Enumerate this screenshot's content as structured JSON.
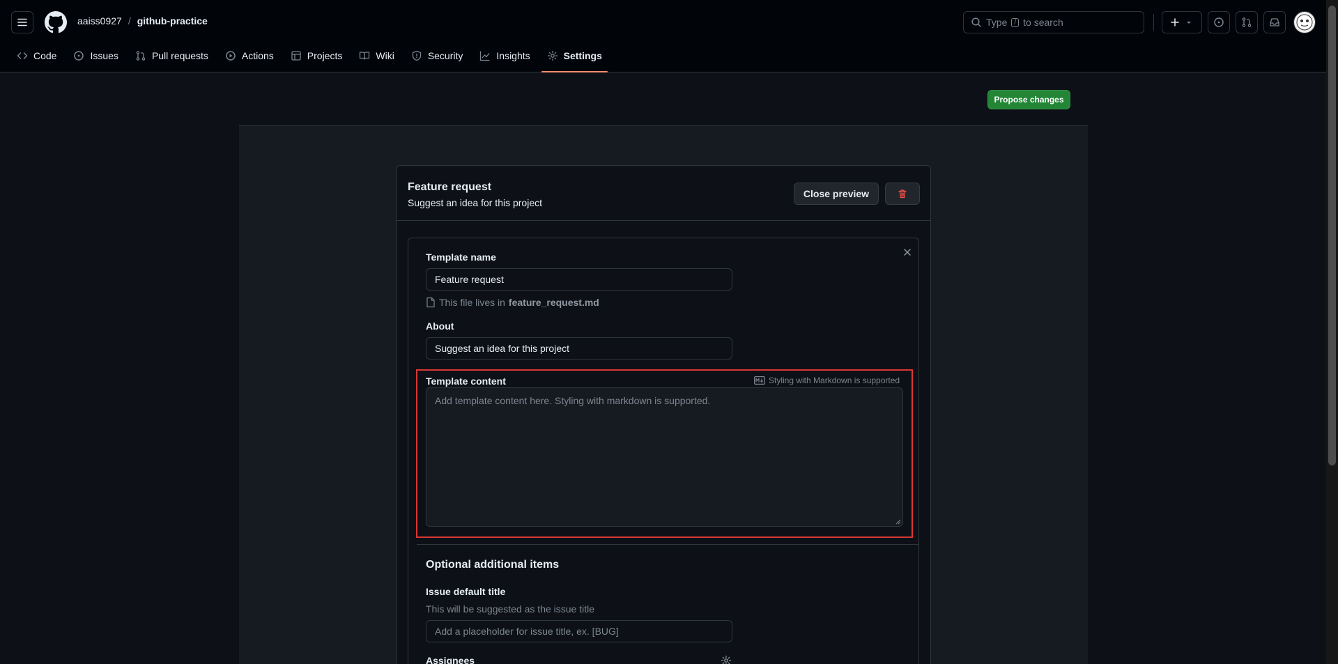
{
  "header": {
    "owner": "aaiss0927",
    "separator": "/",
    "repo": "github-practice",
    "search_prefix": "Type",
    "search_key": "/",
    "search_suffix": "to search"
  },
  "tabs": [
    {
      "label": "Code",
      "icon": "code-icon"
    },
    {
      "label": "Issues",
      "icon": "issue-icon"
    },
    {
      "label": "Pull requests",
      "icon": "pull-request-icon"
    },
    {
      "label": "Actions",
      "icon": "play-icon"
    },
    {
      "label": "Projects",
      "icon": "table-icon"
    },
    {
      "label": "Wiki",
      "icon": "book-icon"
    },
    {
      "label": "Security",
      "icon": "shield-icon"
    },
    {
      "label": "Insights",
      "icon": "graph-icon"
    },
    {
      "label": "Settings",
      "icon": "gear-icon",
      "active": true
    }
  ],
  "main": {
    "propose_label": "Propose changes",
    "card": {
      "title": "Feature request",
      "subtitle": "Suggest an idea for this project",
      "close_preview_label": "Close preview"
    },
    "form": {
      "template_name_label": "Template name",
      "template_name_value": "Feature request",
      "file_hint_prefix": "This file lives in",
      "file_hint_file": "feature_request.md",
      "about_label": "About",
      "about_value": "Suggest an idea for this project",
      "content_label": "Template content",
      "markdown_note": "Styling with Markdown is supported",
      "content_placeholder": "Add template content here. Styling with markdown is supported.",
      "optional_title": "Optional additional items",
      "issue_title_label": "Issue default title",
      "issue_title_hint": "This will be suggested as the issue title",
      "issue_title_placeholder": "Add a placeholder for issue title, ex. [BUG]",
      "assignees_label": "Assignees"
    }
  },
  "colors": {
    "accent_tab": "#fd8c73",
    "primary_button": "#238636",
    "highlight": "#da3633",
    "delete_icon": "#f85149"
  }
}
